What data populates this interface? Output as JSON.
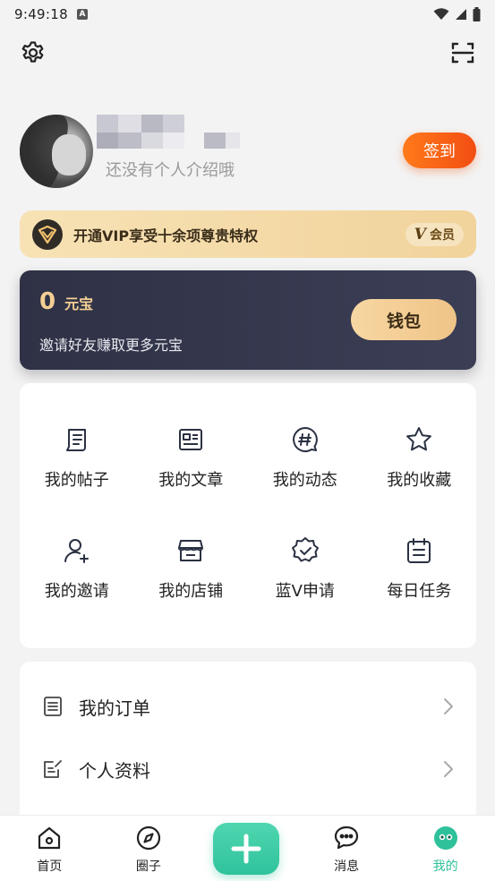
{
  "status_bar": {
    "time": "9:49:18",
    "badge": "A"
  },
  "profile": {
    "bio": "还没有个人介绍哦",
    "checkin_label": "签到"
  },
  "vip": {
    "text": "开通VIP享受十余项尊贵特权",
    "tag_mark": "V",
    "tag_label": "会员"
  },
  "wallet": {
    "amount": "0",
    "unit": "元宝",
    "invite_text": "邀请好友赚取更多元宝",
    "button_label": "钱包"
  },
  "grid": [
    {
      "label": "我的帖子",
      "icon": "post-icon"
    },
    {
      "label": "我的文章",
      "icon": "article-icon"
    },
    {
      "label": "我的动态",
      "icon": "hashtag-chat-icon"
    },
    {
      "label": "我的收藏",
      "icon": "star-icon"
    },
    {
      "label": "我的邀请",
      "icon": "invite-user-icon"
    },
    {
      "label": "我的店铺",
      "icon": "shop-icon"
    },
    {
      "label": "蓝V申请",
      "icon": "verified-badge-icon"
    },
    {
      "label": "每日任务",
      "icon": "calendar-task-icon"
    }
  ],
  "list": [
    {
      "label": "我的订单",
      "icon": "order-icon"
    },
    {
      "label": "个人资料",
      "icon": "edit-profile-icon"
    }
  ],
  "tabs": [
    {
      "label": "首页",
      "icon": "home-icon"
    },
    {
      "label": "圈子",
      "icon": "compass-icon"
    },
    {
      "label": "消息",
      "icon": "message-icon"
    },
    {
      "label": "我的",
      "icon": "me-face-icon"
    }
  ],
  "colors": {
    "accent": "#2ec19a",
    "checkin": "#f24d12",
    "vip_gold": "#f1d39b",
    "wallet_bg": "#2f3246"
  }
}
